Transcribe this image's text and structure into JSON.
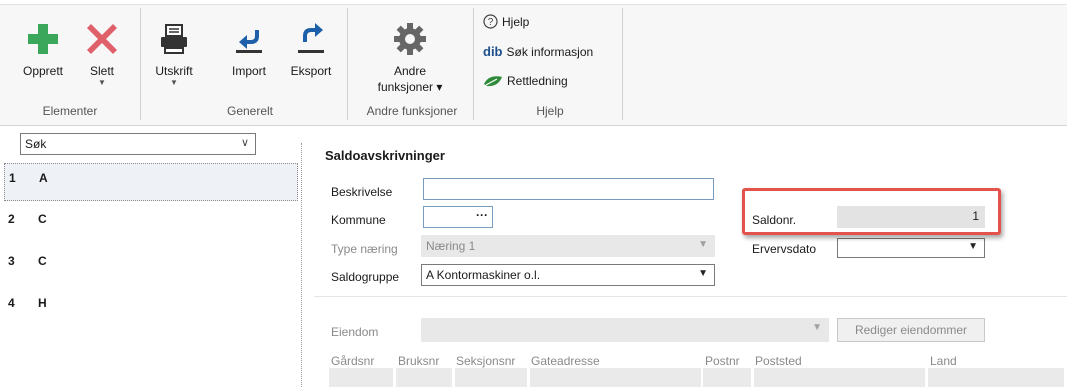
{
  "ribbon": {
    "groups": {
      "elementer": "Elementer",
      "generelt": "Generelt",
      "andre": "Andre funksjoner",
      "hjelp": "Hjelp"
    },
    "buttons": {
      "opprett": "Opprett",
      "slett": "Slett",
      "utskrift": "Utskrift",
      "import": "Import",
      "eksport": "Eksport",
      "andre_line1": "Andre",
      "andre_line2": "funksjoner ▾"
    },
    "help": {
      "hjelp": "Hjelp",
      "dib_logo": "dib",
      "sok": "Søk informasjon",
      "rettledning": "Rettledning"
    }
  },
  "sidebar": {
    "search_value": "Søk",
    "items": [
      {
        "num": "1",
        "name": "A"
      },
      {
        "num": "2",
        "name": "C"
      },
      {
        "num": "3",
        "name": "C"
      },
      {
        "num": "4",
        "name": "H"
      }
    ]
  },
  "form": {
    "title": "Saldoavskrivninger",
    "beskrivelse_label": "Beskrivelse",
    "kommune_label": "Kommune",
    "kommune_button": "···",
    "type_naering_label": "Type næring",
    "type_naering_value": "Næring 1",
    "saldogruppe_label": "Saldogruppe",
    "saldogruppe_value": "A Kontormaskiner o.l.",
    "saldonr_label": "Saldonr.",
    "saldonr_value": "1",
    "ervervsdato_label": "Ervervsdato",
    "eiendom_label": "Eiendom",
    "rediger_button": "Rediger eiendommer",
    "columns": [
      "Gårdsnr",
      "Bruksnr",
      "Seksjonsnr",
      "Gateadresse",
      "Postnr",
      "Poststed",
      "Land"
    ]
  },
  "colors": {
    "accent_green": "#3aa75a",
    "delete_red": "#e0606a",
    "highlight_red": "#e4534b"
  }
}
